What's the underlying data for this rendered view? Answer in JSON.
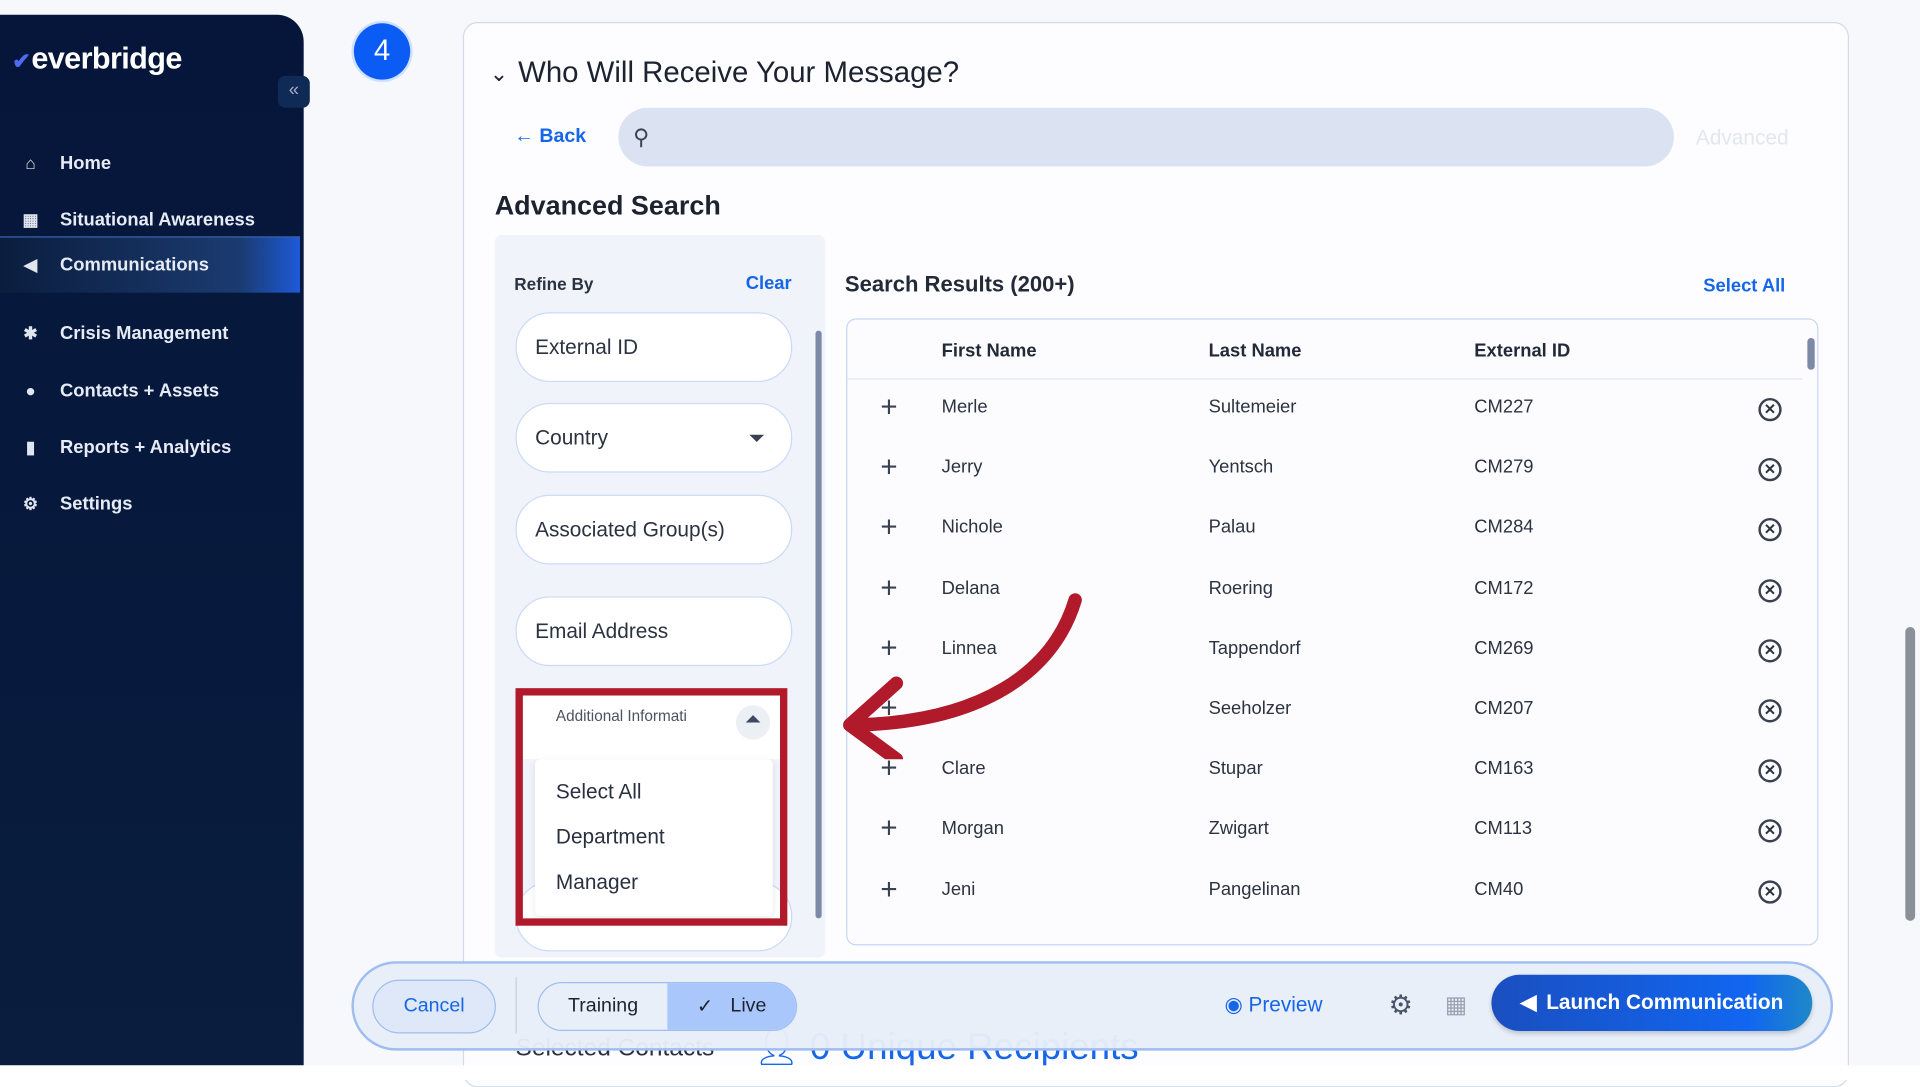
{
  "brand": {
    "logo": "everbridge"
  },
  "sidebar": {
    "items": [
      {
        "label": "Home",
        "icon": "home-icon"
      },
      {
        "label": "Situational Awareness",
        "icon": "map-icon"
      },
      {
        "label": "Communications",
        "icon": "megaphone-icon",
        "active": true
      },
      {
        "label": "Crisis Management",
        "icon": "crisis-icon"
      },
      {
        "label": "Contacts + Assets",
        "icon": "location-pin-icon"
      },
      {
        "label": "Reports + Analytics",
        "icon": "chart-icon"
      },
      {
        "label": "Settings",
        "icon": "gear-icon"
      }
    ]
  },
  "step": {
    "number": "4"
  },
  "section": {
    "title": "Who Will Receive Your Message?",
    "back": "Back",
    "search_placeholder": "",
    "advanced": "Advanced",
    "heading": "Advanced Search"
  },
  "refine": {
    "title": "Refine By",
    "clear": "Clear",
    "fields": [
      "External ID",
      "Country",
      "Associated Group(s)",
      "Email Address"
    ],
    "dropdown": {
      "label": "Additional Informati",
      "options": [
        "Select All",
        "Department",
        "Manager"
      ]
    }
  },
  "results": {
    "title": "Search Results (200+)",
    "select_all": "Select All",
    "columns": [
      "First Name",
      "Last Name",
      "External ID"
    ],
    "rows": [
      [
        "Merle",
        "Sultemeier",
        "CM227"
      ],
      [
        "Jerry",
        "Yentsch",
        "CM279"
      ],
      [
        "Nichole",
        "Palau",
        "CM284"
      ],
      [
        "Delana",
        "Roering",
        "CM172"
      ],
      [
        "Linnea",
        "Tappendorf",
        "CM269"
      ],
      [
        "",
        "Seeholzer",
        "CM207"
      ],
      [
        "Clare",
        "Stupar",
        "CM163"
      ],
      [
        "Morgan",
        "Zwigart",
        "CM113"
      ],
      [
        "Jeni",
        "Pangelinan",
        "CM40"
      ]
    ]
  },
  "footer": {
    "cancel": "Cancel",
    "training": "Training",
    "live": "Live",
    "preview": "Preview",
    "launch": "Launch Communication",
    "selected_contacts": "Selected Contacts",
    "unique_recipients": "0 Unique Recipients"
  },
  "colors": {
    "accent": "#1566e8",
    "annotation": "#b01a2a",
    "sidebar": "#05163a"
  }
}
